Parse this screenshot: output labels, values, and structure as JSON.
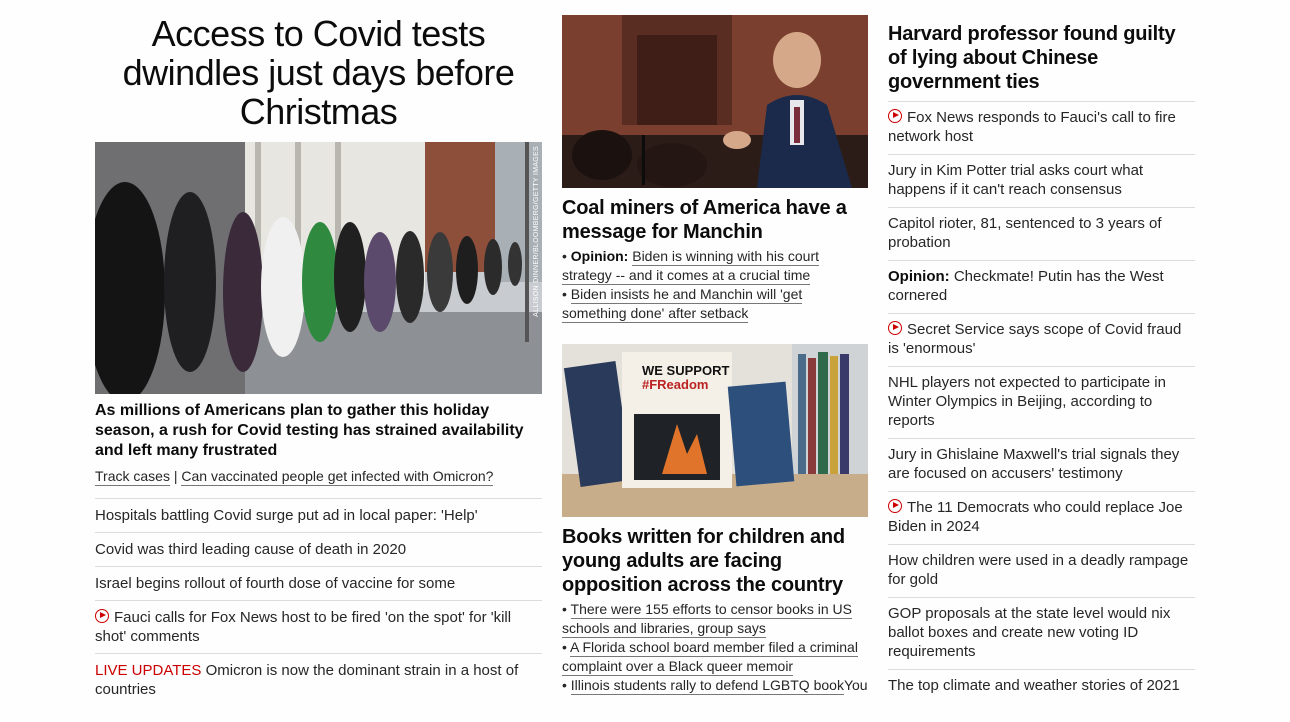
{
  "lead": {
    "headline": "Access to Covid tests dwindles just days before Christmas",
    "image_credit": "ALLISON DINNER/BLOOMBERG/GETTY IMAGES",
    "subhead": "As millions of Americans plan to gather this holiday season, a rush for Covid testing has strained availability and left many frustrated",
    "link1": "Track cases",
    "separator": "|",
    "link2": "Can vaccinated people get infected with Omicron?",
    "stories": [
      {
        "text": "Hospitals battling Covid surge put ad in local paper: 'Help'"
      },
      {
        "text": "Covid was third leading cause of death in 2020"
      },
      {
        "text": "Israel begins rollout of fourth dose of vaccine for some"
      },
      {
        "text": "Fauci calls for Fox News host to be fired 'on the spot' for 'kill shot' comments",
        "icon": "play-icon"
      },
      {
        "prefix": "LIVE UPDATES",
        "text": "Omicron is now the dominant strain in a host of countries"
      }
    ]
  },
  "manchin": {
    "title": "Coal miners of America have a message for Manchin",
    "bullet1_prefix": "Opinion:",
    "bullet1": "Biden is winning with his court strategy -- and it comes at a crucial time",
    "bullet2": "Biden insists he and Manchin will 'get something done' after setback"
  },
  "books": {
    "title": "Books written for children and young adults are facing opposition across the country",
    "sign_line1": "WE SUPPORT",
    "sign_line2": "#FReadom",
    "bullet1": "There were 155 efforts to censor books in US schools and libraries, group says",
    "bullet2": "A Florida school board member filed a criminal complaint over a Black queer memoir",
    "bullet3": "Illinois students rally to defend LGBTQ book",
    "bullet3_tail": "You"
  },
  "right": {
    "title": "Harvard professor found guilty of lying about Chinese government ties",
    "stories": [
      {
        "text": "Fox News responds to Fauci's call to fire network host",
        "icon": "play-icon"
      },
      {
        "text": "Jury in Kim Potter trial asks court what happens if it can't reach consensus"
      },
      {
        "text": "Capitol rioter, 81, sentenced to 3 years of probation"
      },
      {
        "prefix": "Opinion:",
        "text": "Checkmate! Putin has the West cornered"
      },
      {
        "text": "Secret Service says scope of Covid fraud is 'enormous'",
        "icon": "play-icon"
      },
      {
        "text": "NHL players not expected to participate in Winter Olympics in Beijing, according to reports"
      },
      {
        "text": "Jury in Ghislaine Maxwell's trial signals they are focused on accusers' testimony"
      },
      {
        "text": "The 11 Democrats who could replace Joe Biden in 2024",
        "icon": "play-icon"
      },
      {
        "text": "How children were used in a deadly rampage for gold"
      },
      {
        "text": "GOP proposals at the state level would nix ballot boxes and create new voting ID requirements"
      },
      {
        "text": "The top climate and weather stories of 2021"
      }
    ]
  },
  "colors": {
    "accent": "#cc0000",
    "text": "#0c0c0c",
    "divider": "#dcdcdc"
  }
}
